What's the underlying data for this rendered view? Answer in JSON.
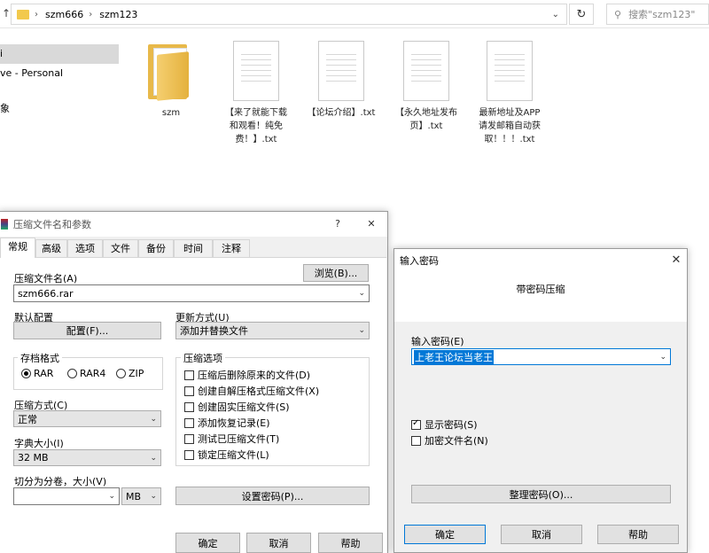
{
  "explorer": {
    "breadcrumb": [
      "szm666",
      "szm123"
    ],
    "search_placeholder": "搜索\"szm123\"",
    "sidebar": [
      "i",
      "ve - Personal",
      "象"
    ],
    "files": [
      {
        "name": "szm",
        "type": "folder"
      },
      {
        "name": "【来了就能下载和观看！纯免费！】.txt",
        "type": "doc",
        "lines": [
          "【来了就能下载",
          "和观看！纯免",
          "费！】.txt"
        ]
      },
      {
        "name": "【论坛介绍】.txt",
        "type": "doc",
        "lines": [
          "【论坛介绍】.txt"
        ]
      },
      {
        "name": "【永久地址发布页】.txt",
        "type": "doc",
        "lines": [
          "【永久地址发布",
          "页】.txt"
        ]
      },
      {
        "name": "最新地址及APP请发邮箱自动获取！！！.txt",
        "type": "doc",
        "lines": [
          "最新地址及APP",
          "请发邮箱自动获",
          "取！！！.txt"
        ]
      }
    ]
  },
  "archive_dialog": {
    "title": "压缩文件名和参数",
    "help": "?",
    "close": "✕",
    "tabs": [
      "常规",
      "高级",
      "选项",
      "文件",
      "备份",
      "时间",
      "注释"
    ],
    "archive_name_label": "压缩文件名(A)",
    "browse": "浏览(B)...",
    "archive_name_value": "szm666.rar",
    "default_profile_label": "默认配置",
    "profiles_btn": "配置(F)...",
    "update_mode_label": "更新方式(U)",
    "update_mode_value": "添加并替换文件",
    "format_group": "存档格式",
    "formats": [
      "RAR",
      "RAR4",
      "ZIP"
    ],
    "selected_format": "RAR",
    "method_label": "压缩方式(C)",
    "method_value": "正常",
    "dict_label": "字典大小(I)",
    "dict_value": "32 MB",
    "split_label": "切分为分卷，大小(V)",
    "split_value": "",
    "split_unit": "MB",
    "options_group": "压缩选项",
    "options": [
      {
        "label": "压缩后删除原来的文件(D)",
        "checked": false
      },
      {
        "label": "创建自解压格式压缩文件(X)",
        "checked": false
      },
      {
        "label": "创建固实压缩文件(S)",
        "checked": false
      },
      {
        "label": "添加恢复记录(E)",
        "checked": false
      },
      {
        "label": "测试已压缩文件(T)",
        "checked": false
      },
      {
        "label": "锁定压缩文件(L)",
        "checked": false
      }
    ],
    "set_password": "设置密码(P)...",
    "ok": "确定",
    "cancel": "取消",
    "help_btn": "帮助"
  },
  "password_dialog": {
    "title": "输入密码",
    "close": "✕",
    "heading": "带密码压缩",
    "pwd_label": "输入密码(E)",
    "pwd_value": "上老王论坛当老王",
    "show_pwd": "显示密码(S)",
    "show_pwd_checked": true,
    "encrypt_names": "加密文件名(N)",
    "encrypt_names_checked": false,
    "organize": "整理密码(O)...",
    "ok": "确定",
    "cancel": "取消",
    "help": "帮助"
  },
  "colors": {
    "accent": "#0078d7",
    "selection": "#0078d7"
  }
}
